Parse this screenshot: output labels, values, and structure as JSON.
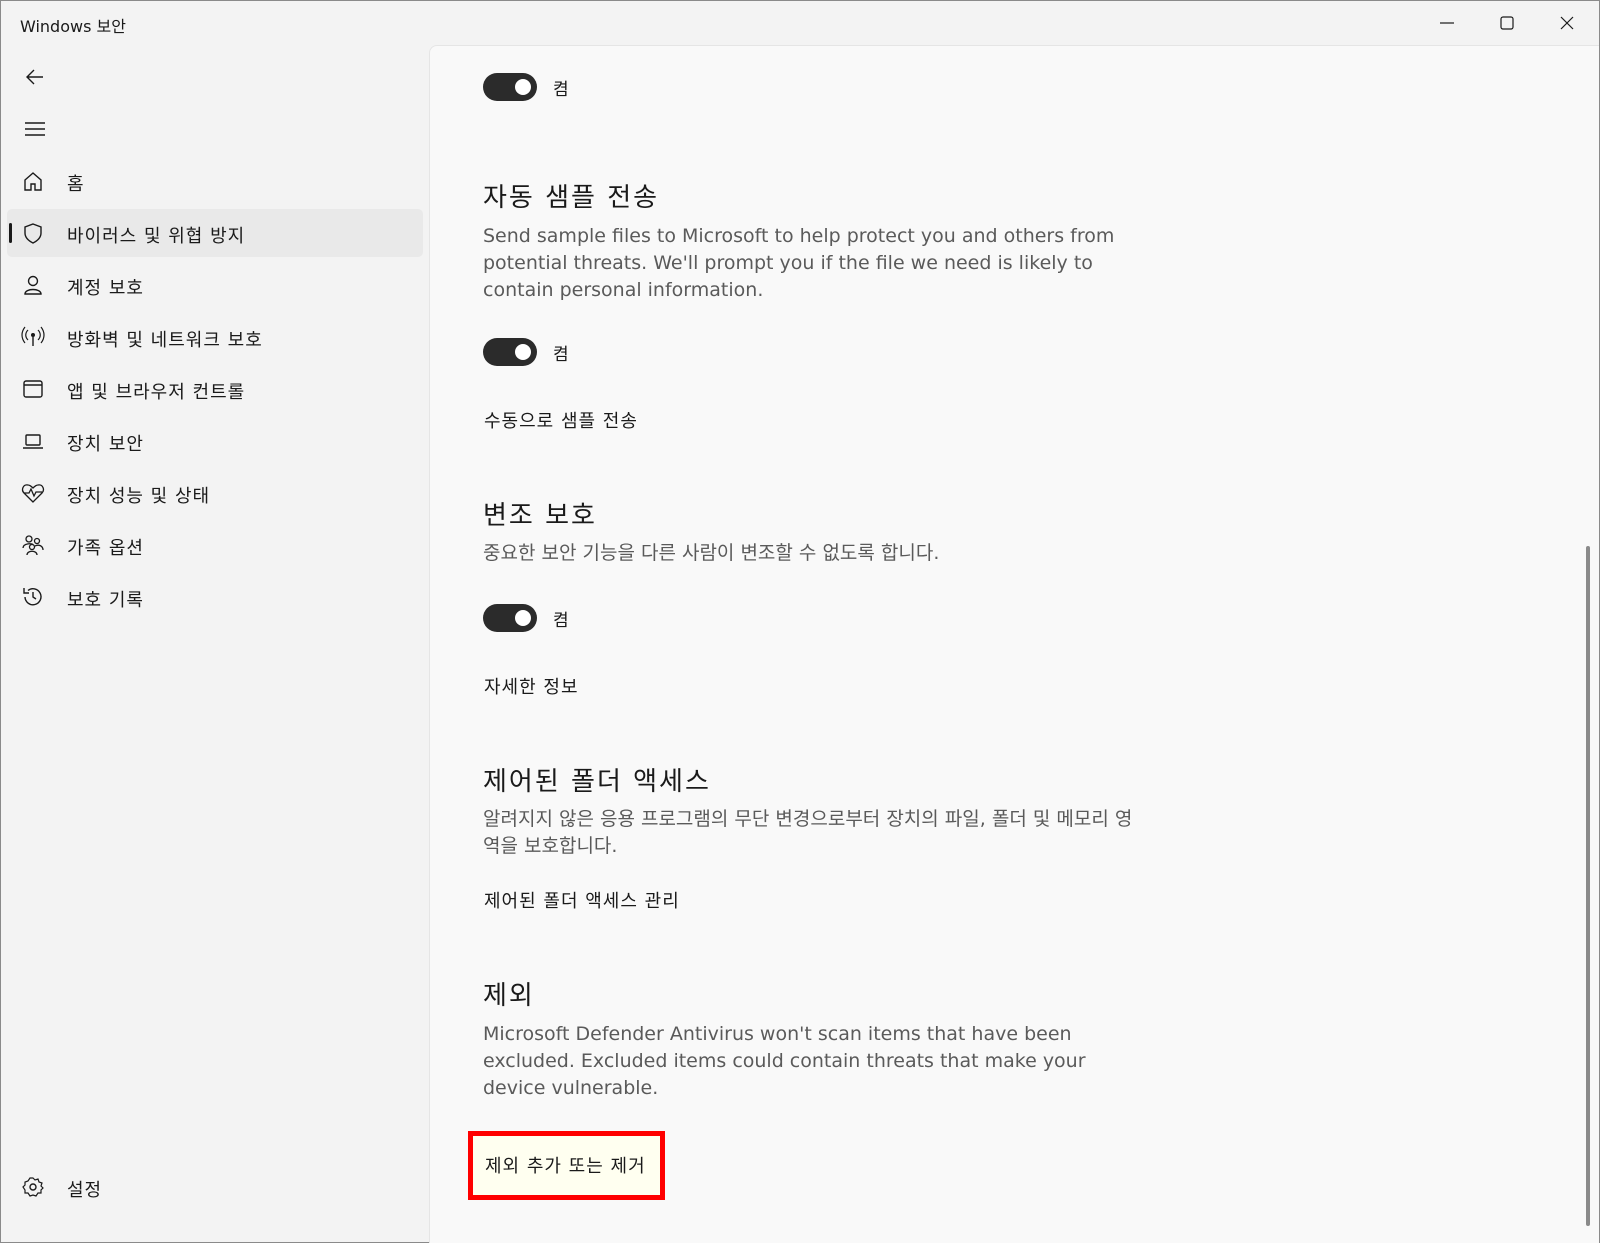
{
  "window": {
    "title": "Windows 보안"
  },
  "sidebar": {
    "items": [
      {
        "label": "홈",
        "icon": "home-icon"
      },
      {
        "label": "바이러스 및 위협 방지",
        "icon": "shield-icon",
        "active": true
      },
      {
        "label": "계정 보호",
        "icon": "person-icon"
      },
      {
        "label": "방화벽 및 네트워크 보호",
        "icon": "antenna-icon"
      },
      {
        "label": "앱 및 브라우저 컨트롤",
        "icon": "app-window-icon"
      },
      {
        "label": "장치 보안",
        "icon": "laptop-icon"
      },
      {
        "label": "장치 성능 및 상태",
        "icon": "heart-pulse-icon"
      },
      {
        "label": "가족 옵션",
        "icon": "family-icon"
      },
      {
        "label": "보호 기록",
        "icon": "history-icon"
      }
    ],
    "settings": {
      "label": "설정",
      "icon": "gear-icon"
    }
  },
  "content": {
    "toggle_top": {
      "label": "켬",
      "on": true
    },
    "auto_sample": {
      "title": "자동 샘플 전송",
      "description": "Send sample files to Microsoft to help protect you and others from potential threats. We'll prompt you if the file we need is likely to contain personal information.",
      "toggle_label": "켬",
      "link": "수동으로 샘플 전송"
    },
    "tamper": {
      "title": "변조 보호",
      "description": "중요한 보안 기능을 다른 사람이 변조할 수 없도록 합니다.",
      "toggle_label": "켬",
      "link": "자세한 정보"
    },
    "cfa": {
      "title": "제어된 폴더 액세스",
      "description": "알려지지 않은 응용 프로그램의 무단 변경으로부터 장치의 파일, 폴더 및 메모리 영역을 보호합니다.",
      "link": "제어된 폴더 액세스 관리"
    },
    "exclusions": {
      "title": "제외",
      "description": "Microsoft Defender Antivirus won't scan items that have been excluded. Excluded items could contain threats that make your device vulnerable.",
      "link": "제외 추가 또는 제거"
    }
  },
  "colors": {
    "highlight_border": "#ff0000",
    "toggle_on": "#2b2b2b"
  }
}
